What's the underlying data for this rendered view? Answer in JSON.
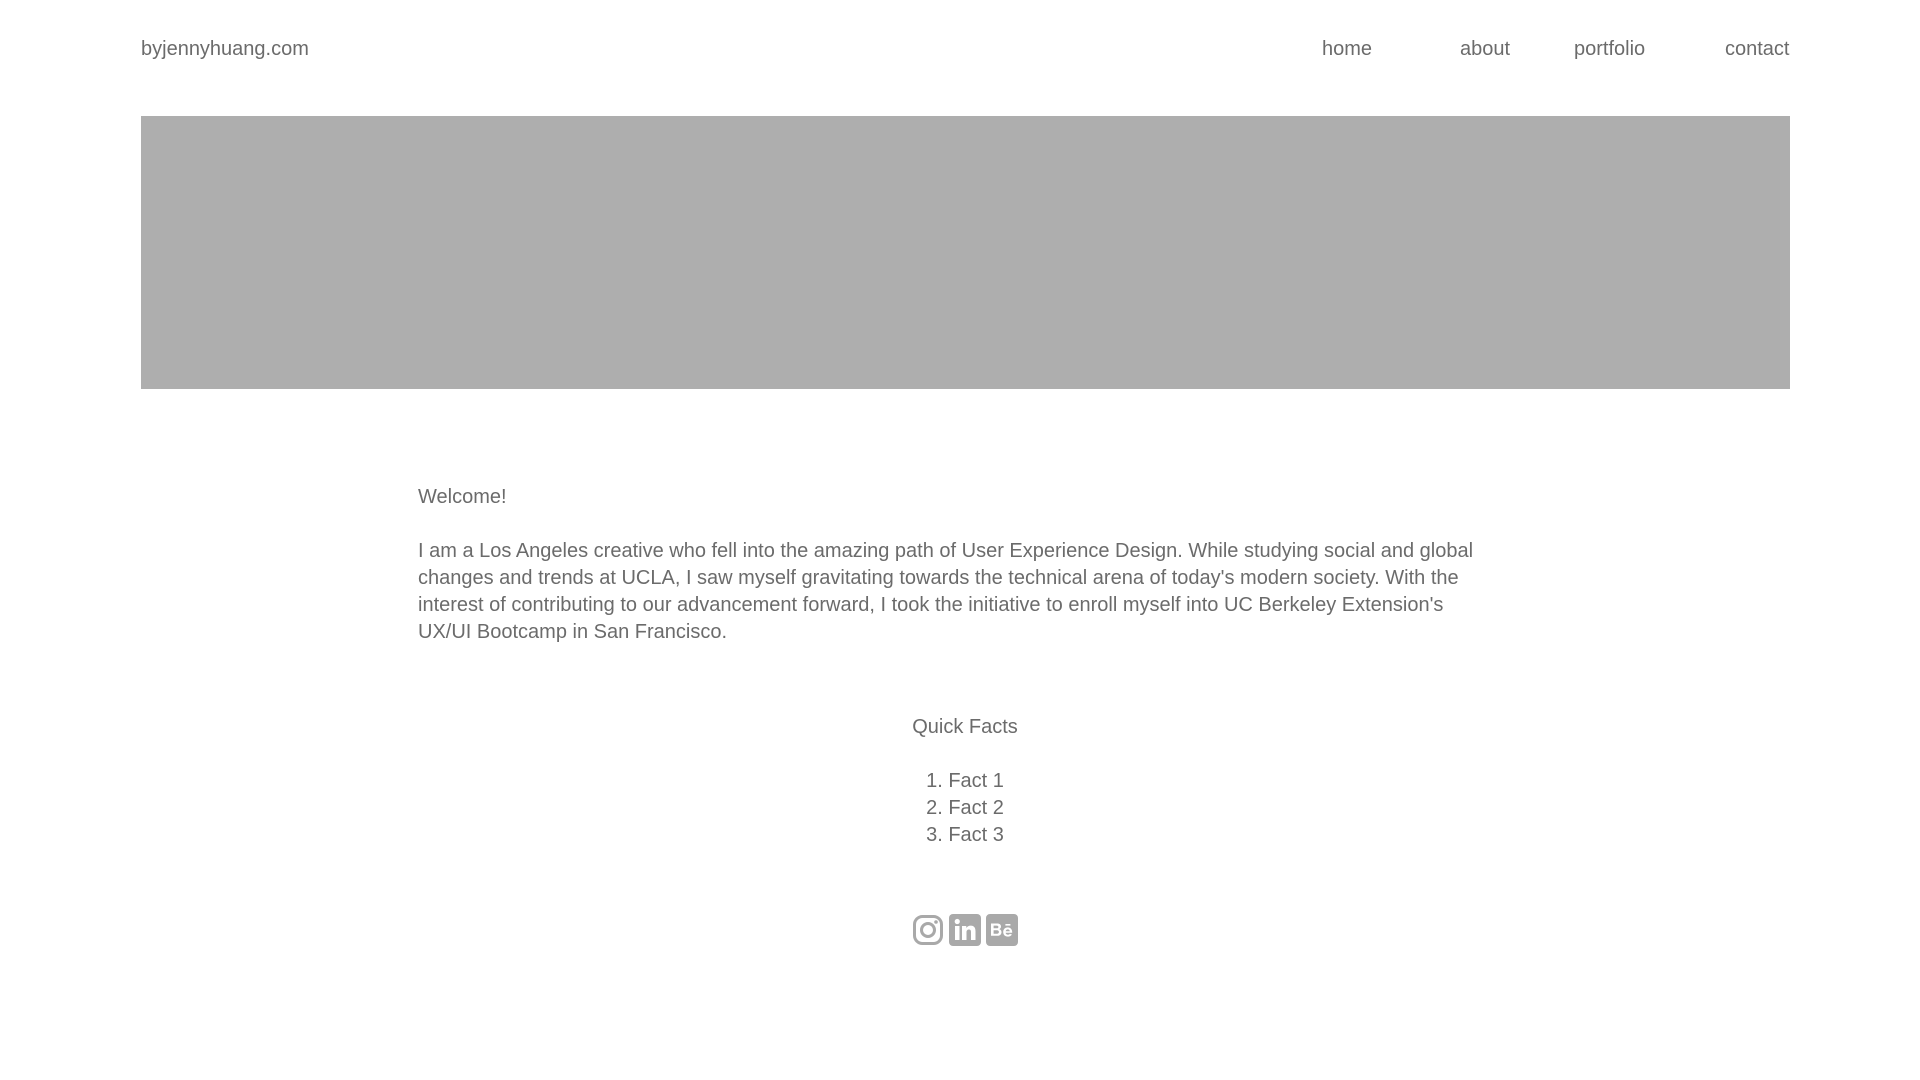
{
  "header": {
    "brand": "byjennyhuang.com",
    "nav": [
      "home",
      "about",
      "portfolio",
      "contact"
    ]
  },
  "hero": {
    "placeholder_color": "#aeaeae"
  },
  "intro": {
    "welcome": "Welcome!",
    "bio": "I am a Los Angeles creative who fell into the amazing path of User Experience Design. While studying social and global changes and trends at UCLA, I saw myself gravitating towards the technical arena of today's modern society. With the interest of contributing to our advancement forward, I took the initiative to enroll myself into UC Berkeley Extension's UX/UI Bootcamp in San Francisco."
  },
  "quick_facts": {
    "title": "Quick Facts",
    "items": [
      "1. Fact 1",
      "2. Fact 2",
      "3. Fact 3"
    ]
  },
  "social": {
    "icons": [
      "instagram-icon",
      "linkedin-icon",
      "behance-icon"
    ],
    "color": "#a9a9a9"
  }
}
